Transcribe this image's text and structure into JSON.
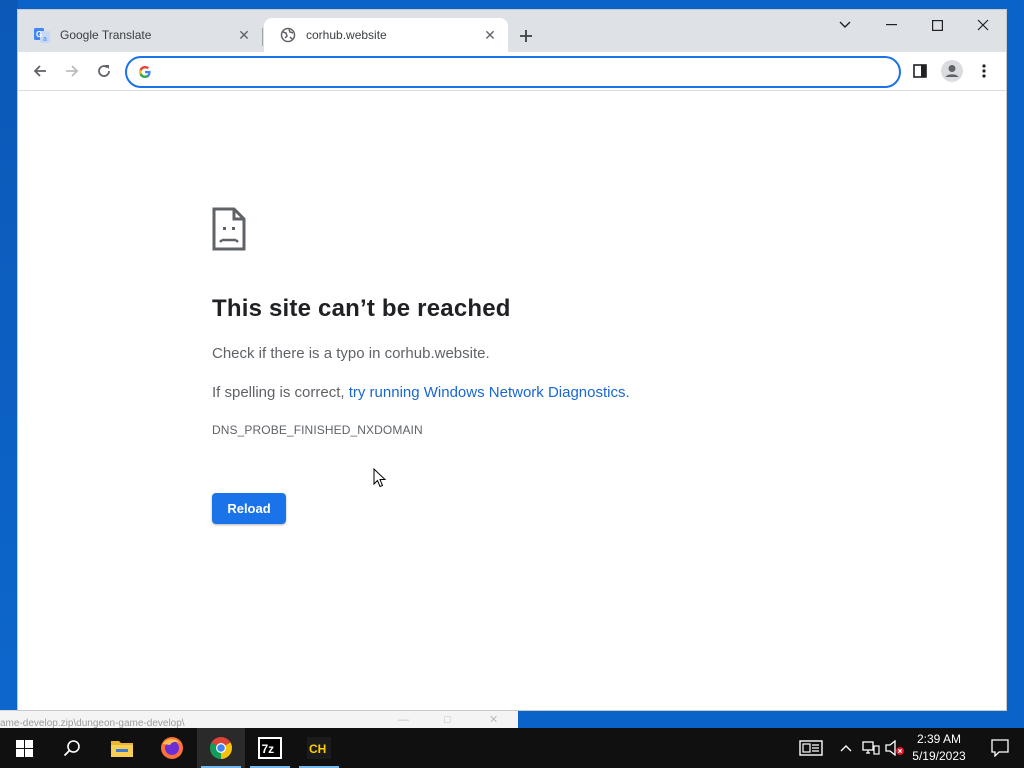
{
  "browser": {
    "tabs": [
      {
        "title": "Google Translate",
        "favicon": "google-translate-icon",
        "active": false
      },
      {
        "title": "corhub.website",
        "favicon": "globe-icon",
        "active": true
      }
    ],
    "omnibox": {
      "value": "",
      "placeholder": ""
    }
  },
  "error_page": {
    "title": "This site can’t be reached",
    "line1": "Check if there is a typo in corhub.website.",
    "line2_prefix": "If spelling is correct, ",
    "line2_link": "try running Windows Network Diagnostics",
    "line2_suffix": ".",
    "error_code": "DNS_PROBE_FINISHED_NXDOMAIN",
    "reload_label": "Reload"
  },
  "behind_window": {
    "title": "ame-develop.zip\\dungeon-game-develop\\"
  },
  "taskbar": {
    "pinned": [
      "start-icon",
      "search-icon",
      "file-explorer-icon",
      "firefox-icon",
      "chrome-icon",
      "7zip-icon",
      "corhub-icon"
    ],
    "sevenzip_label": "7z",
    "corhub_label": "CH",
    "clock_time": "2:39 AM",
    "clock_date": "5/19/2023"
  },
  "colors": {
    "accent": "#1a73e8",
    "link": "#1967d2",
    "taskbar": "#101010"
  }
}
